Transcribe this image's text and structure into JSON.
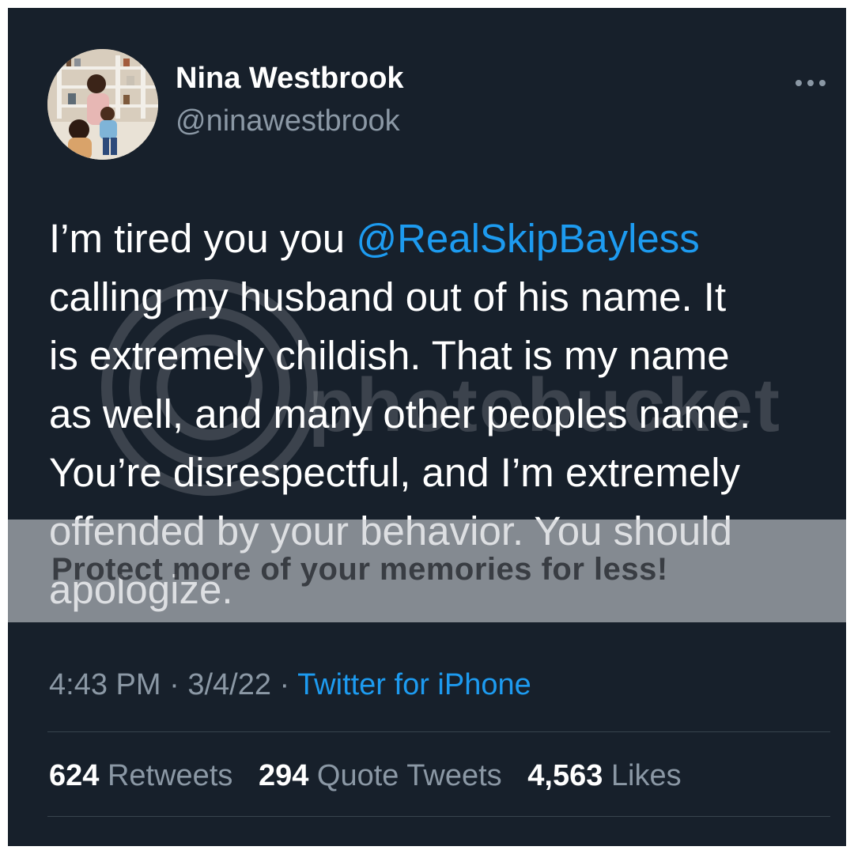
{
  "author": {
    "display_name": "Nina Westbrook",
    "handle": "@ninawestbrook"
  },
  "tweet": {
    "lines": [
      {
        "before": "I’m tired you you ",
        "mention": "@RealSkipBayless",
        "after": ""
      },
      {
        "before": "calling my husband out of his name. It",
        "mention": "",
        "after": ""
      },
      {
        "before": "is extremely childish. That is my name",
        "mention": "",
        "after": ""
      },
      {
        "before": "as well, and many other peoples name.",
        "mention": "",
        "after": ""
      },
      {
        "before": "You’re disrespectful, and I’m extremely",
        "mention": "",
        "after": ""
      },
      {
        "before": "offended by your behavior. You should",
        "mention": "",
        "after": ""
      },
      {
        "before": "apologize.",
        "mention": "",
        "after": ""
      }
    ]
  },
  "meta": {
    "time": "4:43 PM",
    "separator": " · ",
    "date": "3/4/22",
    "source": "Twitter for iPhone"
  },
  "stats": {
    "retweets_count": "624",
    "retweets_label": "Retweets",
    "quotes_count": "294",
    "quotes_label": "Quote Tweets",
    "likes_count": "4,563",
    "likes_label": "Likes"
  },
  "watermark": {
    "brand": "photobucket",
    "banner": "Protect more of your memories for less!"
  },
  "icons": {
    "more": "more-horizontal-icon"
  },
  "colors": {
    "background": "#17202b",
    "accent": "#1d9bf0",
    "secondary_text": "#8b98a5",
    "primary_text": "#ffffff"
  }
}
